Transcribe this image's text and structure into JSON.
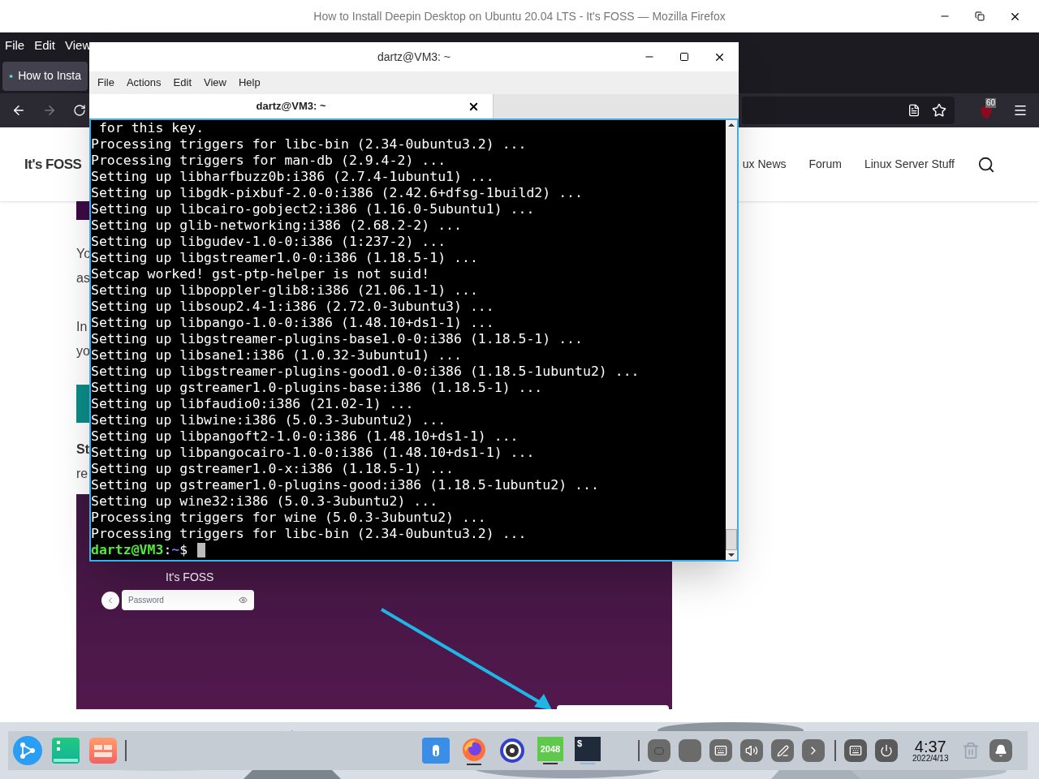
{
  "browser": {
    "title": "How to Install Deepin Desktop on Ubuntu 20.04 LTS - It's FOSS — Mozilla Firefox",
    "menu": [
      "File",
      "Edit",
      "View"
    ],
    "tab": {
      "title": "How to Insta",
      "selected": true
    },
    "extension_badge": "60"
  },
  "website": {
    "logo": "It's FOSS",
    "nav": [
      "ux News",
      "Forum",
      "Linux Server Stuff"
    ],
    "paragraphs": [
      [
        "Yo",
        "as"
      ],
      [
        "In",
        "yo"
      ]
    ],
    "heading": "St",
    "after_heading": [
      "re"
    ],
    "screenshot": {
      "caption": "It's FOSS",
      "password_placeholder": "Password"
    }
  },
  "terminal": {
    "title": "dartz@VM3: ~",
    "menu": [
      "File",
      "Actions",
      "Edit",
      "View",
      "Help"
    ],
    "tab": {
      "title": "dartz@VM3: ~",
      "selected": true
    },
    "lines": [
      " for this key.",
      "Processing triggers for libc-bin (2.34-0ubuntu3.2) ...",
      "Processing triggers for man-db (2.9.4-2) ...",
      "Setting up libharfbuzz0b:i386 (2.7.4-1ubuntu1) ...",
      "Setting up libgdk-pixbuf-2.0-0:i386 (2.42.6+dfsg-1build2) ...",
      "Setting up libcairo-gobject2:i386 (1.16.0-5ubuntu1) ...",
      "Setting up glib-networking:i386 (2.68.2-2) ...",
      "Setting up libgudev-1.0-0:i386 (1:237-2) ...",
      "Setting up libgstreamer1.0-0:i386 (1.18.5-1) ...",
      "Setcap worked! gst-ptp-helper is not suid!",
      "Setting up libpoppler-glib8:i386 (21.06.1-1) ...",
      "Setting up libsoup2.4-1:i386 (2.72.0-3ubuntu3) ...",
      "Setting up libpango-1.0-0:i386 (1.48.10+ds1-1) ...",
      "Setting up libgstreamer-plugins-base1.0-0:i386 (1.18.5-1) ...",
      "Setting up libsane1:i386 (1.0.32-3ubuntu1) ...",
      "Setting up libgstreamer-plugins-good1.0-0:i386 (1.18.5-1ubuntu2) ...",
      "Setting up gstreamer1.0-plugins-base:i386 (1.18.5-1) ...",
      "Setting up libfaudio0:i386 (21.02-1) ...",
      "Setting up libwine:i386 (5.0.3-3ubuntu2) ...",
      "Setting up libpangoft2-1.0-0:i386 (1.48.10+ds1-1) ...",
      "Setting up libpangocairo-1.0-0:i386 (1.48.10+ds1-1) ...",
      "Setting up gstreamer1.0-x:i386 (1.18.5-1) ...",
      "Setting up gstreamer1.0-plugins-good:i386 (1.18.5-1ubuntu2) ...",
      "Setting up wine32:i386 (5.0.3-3ubuntu2) ...",
      "Processing triggers for wine (5.0.3-3ubuntu2) ...",
      "Processing triggers for libc-bin (2.34-0ubuntu3.2) ..."
    ],
    "prompt": {
      "user": "dartz@VM3",
      "separator": ":",
      "path": "~",
      "symbol": "$"
    }
  },
  "dock": {
    "game_label": "2048",
    "terminal_label": "$",
    "time": "4:37",
    "date": "2022/4/13"
  }
}
